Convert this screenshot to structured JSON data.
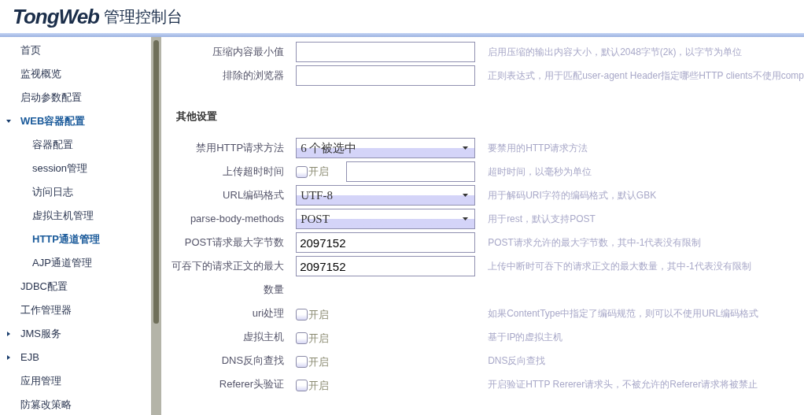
{
  "header": {
    "logo": "TongWeb",
    "title": "管理控制台"
  },
  "sidebar": {
    "items": [
      {
        "label": "首页",
        "selected": false
      },
      {
        "label": "监视概览",
        "selected": false
      },
      {
        "label": "启动参数配置",
        "selected": false
      },
      {
        "label": "WEB容器配置",
        "selected": true,
        "expanded": true,
        "children": [
          {
            "label": "容器配置",
            "selected": false
          },
          {
            "label": "session管理",
            "selected": false
          },
          {
            "label": "访问日志",
            "selected": false
          },
          {
            "label": "虚拟主机管理",
            "selected": false
          },
          {
            "label": "HTTP通道管理",
            "selected": true
          },
          {
            "label": "AJP通道管理",
            "selected": false
          }
        ]
      },
      {
        "label": "JDBC配置",
        "selected": false
      },
      {
        "label": "工作管理器",
        "selected": false
      },
      {
        "label": "JMS服务",
        "selected": false,
        "expanded": false
      },
      {
        "label": "EJB",
        "selected": false,
        "expanded": false
      },
      {
        "label": "应用管理",
        "selected": false
      },
      {
        "label": "防篡改策略",
        "selected": false
      }
    ]
  },
  "form": {
    "sections": [
      {
        "rows": [
          {
            "kind": "text",
            "label": "压缩内容最小值",
            "hint": "启用压缩的输出内容大小，默认2048字节(2k)，以字节为单位"
          },
          {
            "kind": "text",
            "label": "排除的浏览器",
            "hint": "正则表达式，用于匹配user-agent Header指定哪些HTTP clients不使用comp"
          }
        ]
      },
      {
        "title": "其他设置",
        "rows": [
          {
            "kind": "select",
            "label": "禁用HTTP请求方法",
            "value": "6 个被选中",
            "hint": "要禁用的HTTP请求方法"
          },
          {
            "kind": "checkbox_text",
            "label": "上传超时时间",
            "checkbox_label": "开启",
            "checked": false,
            "hint": "超时时间，以毫秒为单位"
          },
          {
            "kind": "select",
            "label": "URL编码格式",
            "value": "UTF-8",
            "hint": "用于解码URI字符的编码格式，默认GBK"
          },
          {
            "kind": "select",
            "label": "parse-body-methods",
            "value": "POST",
            "hint": "用于rest，默认支持POST"
          },
          {
            "kind": "text",
            "label": "POST请求最大字节数",
            "value": "2097152",
            "hint": "POST请求允许的最大字节数，其中-1代表没有限制"
          },
          {
            "kind": "text",
            "label": "可吞下的请求正文的最大数量",
            "value": "2097152",
            "hint": "上传中断时可吞下的请求正文的最大数量，其中-1代表没有限制"
          },
          {
            "kind": "checkbox",
            "label": "uri处理",
            "checkbox_label": "开启",
            "checked": false,
            "hint": "如果ContentType中指定了编码规范，则可以不使用URL编码格式"
          },
          {
            "kind": "checkbox",
            "label": "虚拟主机",
            "checkbox_label": "开启",
            "checked": false,
            "hint": "基于IP的虚拟主机"
          },
          {
            "kind": "checkbox",
            "label": "DNS反向查找",
            "checkbox_label": "开启",
            "checked": false,
            "hint": "DNS反向查找"
          },
          {
            "kind": "checkbox",
            "label": "Referer头验证",
            "checkbox_label": "开启",
            "checked": false,
            "hint": "开启验证HTTP Rererer请求头，不被允许的Referer请求将被禁止"
          }
        ]
      }
    ]
  }
}
